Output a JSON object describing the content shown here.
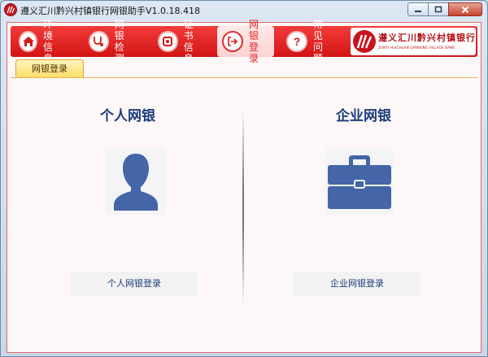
{
  "window": {
    "title": "遵义汇川黔兴村镇银行网银助手V1.0.18.418"
  },
  "nav": {
    "items": [
      {
        "label": "环境信息",
        "icon": "home-icon"
      },
      {
        "label": "网银检测",
        "icon": "stethoscope-icon"
      },
      {
        "label": "证书信息",
        "icon": "certificate-icon"
      },
      {
        "label": "网银登录",
        "icon": "login-icon"
      },
      {
        "label": "常见问题",
        "icon": "question-icon"
      }
    ],
    "active": "网银登录"
  },
  "brand": {
    "name": "遵义汇川黔兴村镇银行",
    "name_en": "ZUNYI HUICHUAN QIANXING VILLAGE BANK"
  },
  "tabs": [
    {
      "label": "网银登录"
    }
  ],
  "panels": {
    "personal": {
      "title": "个人网银",
      "button": "个人网银登录",
      "icon": "person-icon"
    },
    "business": {
      "title": "企业网银",
      "button": "企业网银登录",
      "icon": "briefcase-icon"
    }
  },
  "colors": {
    "nav_red": "#e02424",
    "title_blue": "#1d3c7a",
    "icon_blue": "#4466a8",
    "tab_yellow": "#ffde65"
  }
}
